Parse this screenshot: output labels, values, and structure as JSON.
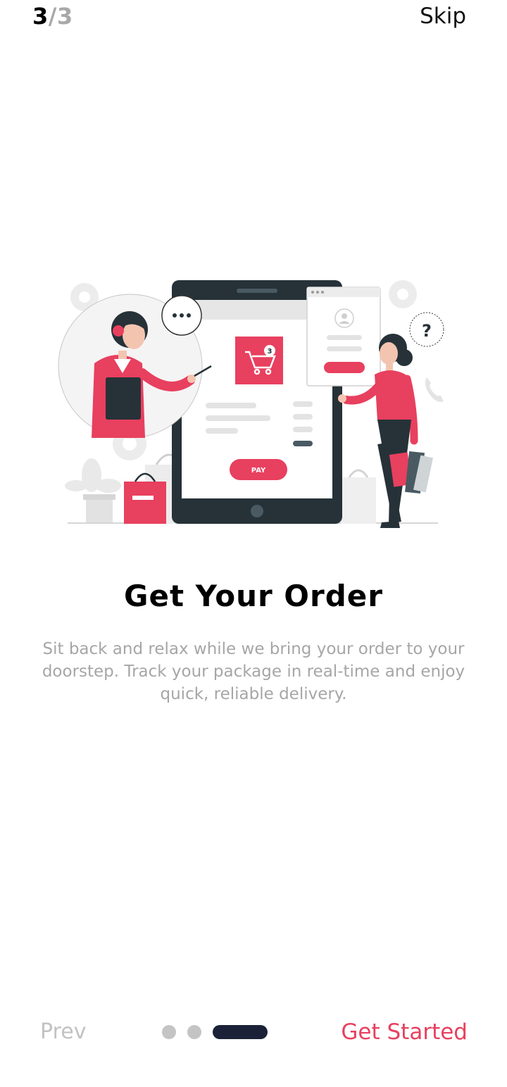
{
  "header": {
    "page_current": "3",
    "page_separator": "/",
    "page_total": "3",
    "skip_label": "Skip"
  },
  "illustration": {
    "pay_label": "PAY",
    "cart_badge": "3",
    "question_mark": "?"
  },
  "content": {
    "title": "Get Your Order",
    "description": "Sit back and relax while we bring your order to your doorstep. Track your package in real-time and enjoy quick, reliable delivery."
  },
  "footer": {
    "prev_label": "Prev",
    "next_label": "Get Started",
    "pages_count": 3,
    "active_page": 3
  },
  "colors": {
    "accent": "#e8405f",
    "dark": "#263238",
    "dot_active": "#1b2238",
    "dot_inactive": "#c4c4c4",
    "muted_text": "#a6a6a6"
  }
}
